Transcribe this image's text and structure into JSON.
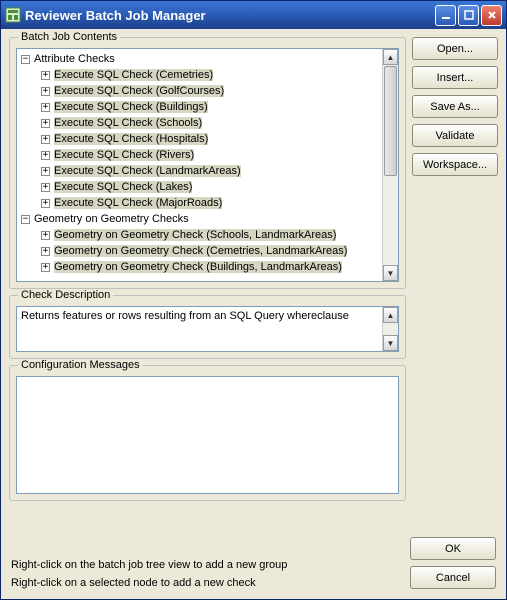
{
  "window": {
    "title": "Reviewer Batch Job Manager"
  },
  "sections": {
    "batch_job_contents": "Batch Job Contents",
    "check_description": "Check Description",
    "configuration_messages": "Configuration Messages"
  },
  "tree": {
    "group1_label": "Attribute Checks",
    "group1_items": [
      "Execute SQL Check (Cemetries)",
      "Execute SQL Check (GolfCourses)",
      "Execute SQL Check (Buildings)",
      "Execute SQL Check (Schools)",
      "Execute SQL Check (Hospitals)",
      "Execute SQL Check (Rivers)",
      "Execute SQL Check (LandmarkAreas)",
      "Execute SQL Check (Lakes)",
      "Execute SQL Check (MajorRoads)"
    ],
    "group2_label": "Geometry on Geometry Checks",
    "group2_items": [
      "Geometry on Geometry Check (Schools, LandmarkAreas)",
      "Geometry on Geometry Check (Cemetries, LandmarkAreas)",
      "Geometry on Geometry Check (Buildings, LandmarkAreas)"
    ]
  },
  "check_description_text": "Returns features or rows resulting from an SQL Query whereclause",
  "buttons": {
    "open": "Open...",
    "insert": "Insert...",
    "save_as": "Save As...",
    "validate": "Validate",
    "workspace": "Workspace...",
    "ok": "OK",
    "cancel": "Cancel"
  },
  "hints": {
    "line1": "Right-click on the batch job tree view to add a new group",
    "line2": "Right-click on a selected node to add a new check"
  },
  "glyphs": {
    "minus": "−",
    "plus": "+",
    "up": "▲",
    "down": "▼"
  }
}
